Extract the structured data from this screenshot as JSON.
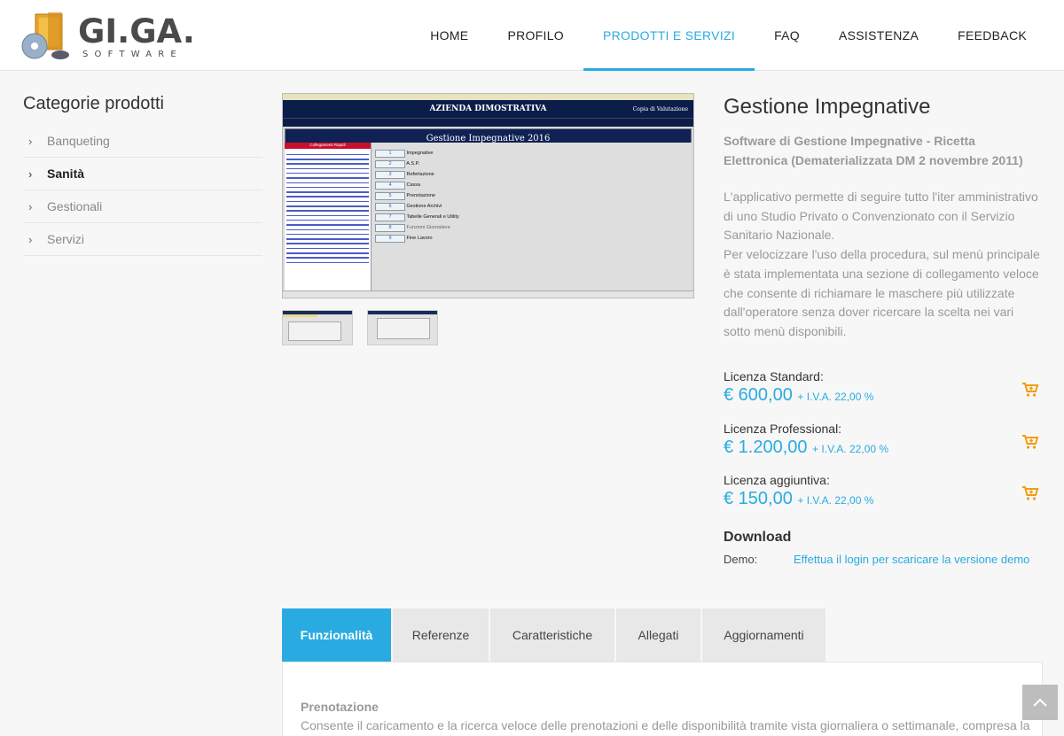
{
  "brand": {
    "name": "GI.GA.",
    "tagline": "SOFTWARE"
  },
  "nav": {
    "items": [
      "HOME",
      "PROFILO",
      "PRODOTTI E SERVIZI",
      "FAQ",
      "ASSISTENZA",
      "FEEDBACK"
    ],
    "active": "PRODOTTI E SERVIZI"
  },
  "sidebar": {
    "title": "Categorie prodotti",
    "items": [
      {
        "label": "Banqueting"
      },
      {
        "label": "Sanità"
      },
      {
        "label": "Gestionali"
      },
      {
        "label": "Servizi"
      }
    ],
    "active": "Sanità"
  },
  "screenshot": {
    "company": "AZIENDA DIMOSTRATIVA",
    "copy_label": "Copia di Valutazione",
    "window_title": "Gestione Impegnative 2016",
    "quick_links_title": "Collegamenti Rapidi",
    "menu": [
      {
        "num": "1",
        "label": "Impegnative"
      },
      {
        "num": "2",
        "label": "A.S.P."
      },
      {
        "num": "3",
        "label": "Refertazione"
      },
      {
        "num": "4",
        "label": "Cassa"
      },
      {
        "num": "5",
        "label": "Prenotazione"
      },
      {
        "num": "6",
        "label": "Gestione Archivi"
      },
      {
        "num": "7",
        "label": "Tabelle Generali e Utility"
      },
      {
        "num": "8",
        "label": "Funzioni Giornaliere"
      },
      {
        "num": "9",
        "label": "Fine Lavoro"
      }
    ]
  },
  "product": {
    "title": "Gestione Impegnative",
    "subtitle": "Software di Gestione Impegnative - Ricetta Elettronica (Dematerializzata DM 2 novembre 2011)",
    "description_1": "L'applicativo permette di seguire tutto l'iter amministrativo di uno Studio Privato o Convenzionato con il Servizio Sanitario Nazionale.",
    "description_2": "Per velocizzare l'uso della procedura, sul menù principale è stata implementata una sezione di collegamento veloce che consente di richiamare le maschere più utilizzate dall'operatore senza dover ricercare la scelta nei vari sotto menù disponibili."
  },
  "licenses": [
    {
      "label": "Licenza Standard:",
      "price": "€ 600,00",
      "vat": "+ I.V.A. 22,00 %"
    },
    {
      "label": "Licenza Professional:",
      "price": "€ 1.200,00",
      "vat": "+ I.V.A. 22,00 %"
    },
    {
      "label": "Licenza aggiuntiva:",
      "price": "€ 150,00",
      "vat": "+ I.V.A. 22,00 %"
    }
  ],
  "download": {
    "title": "Download",
    "demo_label": "Demo:",
    "demo_link": "Effettua il login per scaricare la versione demo"
  },
  "tabs": {
    "items": [
      "Funzionalità",
      "Referenze",
      "Caratteristiche",
      "Allegati",
      "Aggiornamenti"
    ],
    "active": "Funzionalità"
  },
  "panel": {
    "heading": "Prenotazione",
    "text": "Consente il caricamento e la ricerca veloce delle prenotazioni e delle disponibilità tramite vista giornaliera o settimanale, compresa la"
  },
  "colors": {
    "accent": "#29abe2",
    "cart": "#f39c12"
  },
  "icons": {
    "chevron": "chevron-right-icon",
    "cart": "cart-plus-icon",
    "totop": "arrow-up-icon"
  }
}
